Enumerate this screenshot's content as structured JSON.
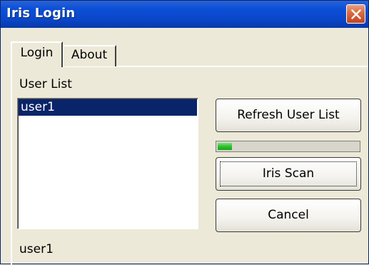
{
  "window": {
    "title": "Iris Login"
  },
  "tabs": [
    {
      "label": "Login",
      "active": true
    },
    {
      "label": "About",
      "active": false
    }
  ],
  "main": {
    "user_list_label": "User List",
    "users": [
      "user1"
    ],
    "selected_user": "user1",
    "status_text": "user1"
  },
  "buttons": {
    "refresh": "Refresh User List",
    "iris_scan": "Iris Scan",
    "cancel": "Cancel"
  },
  "progress": {
    "fraction": 0.1,
    "color": "#2fc02f"
  },
  "colors": {
    "title_bar": "#0b4fd8",
    "selection": "#0a246a",
    "close_button": "#d96a3f"
  },
  "icons": {
    "close": "close-icon"
  }
}
